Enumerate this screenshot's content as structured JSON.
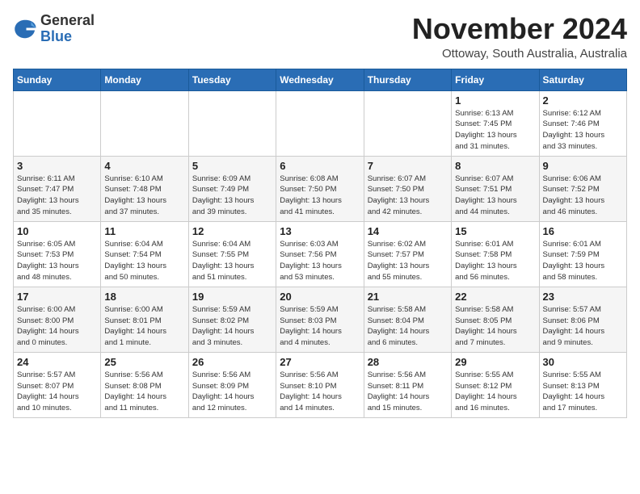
{
  "header": {
    "logo_line1": "General",
    "logo_line2": "Blue",
    "month": "November 2024",
    "location": "Ottoway, South Australia, Australia"
  },
  "days_of_week": [
    "Sunday",
    "Monday",
    "Tuesday",
    "Wednesday",
    "Thursday",
    "Friday",
    "Saturday"
  ],
  "weeks": [
    [
      {
        "day": "",
        "info": ""
      },
      {
        "day": "",
        "info": ""
      },
      {
        "day": "",
        "info": ""
      },
      {
        "day": "",
        "info": ""
      },
      {
        "day": "",
        "info": ""
      },
      {
        "day": "1",
        "info": "Sunrise: 6:13 AM\nSunset: 7:45 PM\nDaylight: 13 hours\nand 31 minutes."
      },
      {
        "day": "2",
        "info": "Sunrise: 6:12 AM\nSunset: 7:46 PM\nDaylight: 13 hours\nand 33 minutes."
      }
    ],
    [
      {
        "day": "3",
        "info": "Sunrise: 6:11 AM\nSunset: 7:47 PM\nDaylight: 13 hours\nand 35 minutes."
      },
      {
        "day": "4",
        "info": "Sunrise: 6:10 AM\nSunset: 7:48 PM\nDaylight: 13 hours\nand 37 minutes."
      },
      {
        "day": "5",
        "info": "Sunrise: 6:09 AM\nSunset: 7:49 PM\nDaylight: 13 hours\nand 39 minutes."
      },
      {
        "day": "6",
        "info": "Sunrise: 6:08 AM\nSunset: 7:50 PM\nDaylight: 13 hours\nand 41 minutes."
      },
      {
        "day": "7",
        "info": "Sunrise: 6:07 AM\nSunset: 7:50 PM\nDaylight: 13 hours\nand 42 minutes."
      },
      {
        "day": "8",
        "info": "Sunrise: 6:07 AM\nSunset: 7:51 PM\nDaylight: 13 hours\nand 44 minutes."
      },
      {
        "day": "9",
        "info": "Sunrise: 6:06 AM\nSunset: 7:52 PM\nDaylight: 13 hours\nand 46 minutes."
      }
    ],
    [
      {
        "day": "10",
        "info": "Sunrise: 6:05 AM\nSunset: 7:53 PM\nDaylight: 13 hours\nand 48 minutes."
      },
      {
        "day": "11",
        "info": "Sunrise: 6:04 AM\nSunset: 7:54 PM\nDaylight: 13 hours\nand 50 minutes."
      },
      {
        "day": "12",
        "info": "Sunrise: 6:04 AM\nSunset: 7:55 PM\nDaylight: 13 hours\nand 51 minutes."
      },
      {
        "day": "13",
        "info": "Sunrise: 6:03 AM\nSunset: 7:56 PM\nDaylight: 13 hours\nand 53 minutes."
      },
      {
        "day": "14",
        "info": "Sunrise: 6:02 AM\nSunset: 7:57 PM\nDaylight: 13 hours\nand 55 minutes."
      },
      {
        "day": "15",
        "info": "Sunrise: 6:01 AM\nSunset: 7:58 PM\nDaylight: 13 hours\nand 56 minutes."
      },
      {
        "day": "16",
        "info": "Sunrise: 6:01 AM\nSunset: 7:59 PM\nDaylight: 13 hours\nand 58 minutes."
      }
    ],
    [
      {
        "day": "17",
        "info": "Sunrise: 6:00 AM\nSunset: 8:00 PM\nDaylight: 14 hours\nand 0 minutes."
      },
      {
        "day": "18",
        "info": "Sunrise: 6:00 AM\nSunset: 8:01 PM\nDaylight: 14 hours\nand 1 minute."
      },
      {
        "day": "19",
        "info": "Sunrise: 5:59 AM\nSunset: 8:02 PM\nDaylight: 14 hours\nand 3 minutes."
      },
      {
        "day": "20",
        "info": "Sunrise: 5:59 AM\nSunset: 8:03 PM\nDaylight: 14 hours\nand 4 minutes."
      },
      {
        "day": "21",
        "info": "Sunrise: 5:58 AM\nSunset: 8:04 PM\nDaylight: 14 hours\nand 6 minutes."
      },
      {
        "day": "22",
        "info": "Sunrise: 5:58 AM\nSunset: 8:05 PM\nDaylight: 14 hours\nand 7 minutes."
      },
      {
        "day": "23",
        "info": "Sunrise: 5:57 AM\nSunset: 8:06 PM\nDaylight: 14 hours\nand 9 minutes."
      }
    ],
    [
      {
        "day": "24",
        "info": "Sunrise: 5:57 AM\nSunset: 8:07 PM\nDaylight: 14 hours\nand 10 minutes."
      },
      {
        "day": "25",
        "info": "Sunrise: 5:56 AM\nSunset: 8:08 PM\nDaylight: 14 hours\nand 11 minutes."
      },
      {
        "day": "26",
        "info": "Sunrise: 5:56 AM\nSunset: 8:09 PM\nDaylight: 14 hours\nand 12 minutes."
      },
      {
        "day": "27",
        "info": "Sunrise: 5:56 AM\nSunset: 8:10 PM\nDaylight: 14 hours\nand 14 minutes."
      },
      {
        "day": "28",
        "info": "Sunrise: 5:56 AM\nSunset: 8:11 PM\nDaylight: 14 hours\nand 15 minutes."
      },
      {
        "day": "29",
        "info": "Sunrise: 5:55 AM\nSunset: 8:12 PM\nDaylight: 14 hours\nand 16 minutes."
      },
      {
        "day": "30",
        "info": "Sunrise: 5:55 AM\nSunset: 8:13 PM\nDaylight: 14 hours\nand 17 minutes."
      }
    ]
  ]
}
